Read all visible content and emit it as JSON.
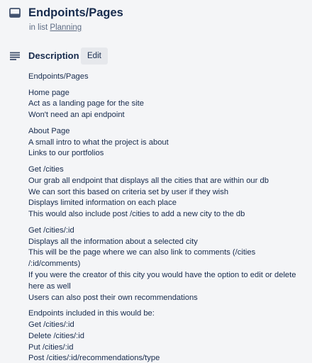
{
  "card": {
    "title": "Endpoints/Pages",
    "list_prefix": "in list",
    "list_name": "Planning"
  },
  "description": {
    "heading": "Description",
    "edit_label": "Edit",
    "paragraphs": [
      [
        "Endpoints/Pages"
      ],
      [
        "Home page",
        "Act as a landing page for the site",
        "Won't need an api endpoint"
      ],
      [
        "About Page",
        "A small intro to what the project is about",
        "Links to our portfolios"
      ],
      [
        "Get /cities",
        "Our grab all endpoint that displays all the cities that are within our db",
        "We can sort this based on criteria set by user if they wish",
        "Displays limited information on each place",
        "This would also include post /cities to add a new city to the db"
      ],
      [
        "Get /cities/:id",
        "Displays all the information about a selected city",
        "This will be the page where we can also link to comments (/cities",
        "/:id/comments)",
        "If you were the creator of this city you would have the option to edit or delete",
        "here as well",
        "Users can also post their own recommendations"
      ],
      [
        "Endpoints included in this would be:",
        "Get /cities/:id",
        "Delete /cities/:id",
        "Put /cities/:id",
        "Post /cities/:id/recommendations/type"
      ]
    ]
  },
  "icons": {
    "card_icon": "card-icon",
    "description_icon": "description-lines-icon"
  }
}
